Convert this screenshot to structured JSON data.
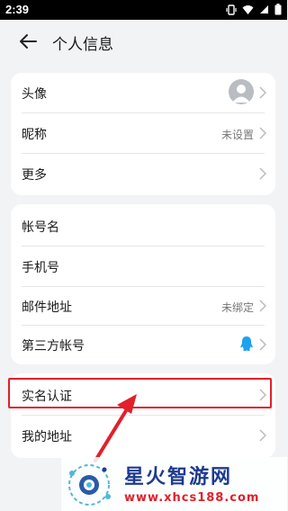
{
  "status_bar": {
    "time": "2:39"
  },
  "header": {
    "title": "个人信息"
  },
  "profile_card": {
    "avatar_label": "头像",
    "nickname_label": "昵称",
    "nickname_value": "未设置",
    "more_label": "更多"
  },
  "account_card": {
    "account_name_label": "帐号名",
    "phone_label": "手机号",
    "email_label": "邮件地址",
    "email_value": "未绑定",
    "third_party_label": "第三方帐号"
  },
  "verify_card": {
    "real_name_label": "实名认证",
    "my_address_label": "我的地址"
  },
  "watermark": {
    "title": "星火智游网",
    "url": "www.xhcs188.com"
  },
  "colors": {
    "highlight": "#e1202b",
    "qq_blue": "#1ea1f0",
    "background": "#f1f3f5"
  },
  "icons": [
    "wifi-icon",
    "signal-icon",
    "battery-icon",
    "vibrate-icon",
    "back-arrow-icon",
    "avatar-icon",
    "chevron-right-icon",
    "qq-icon"
  ]
}
